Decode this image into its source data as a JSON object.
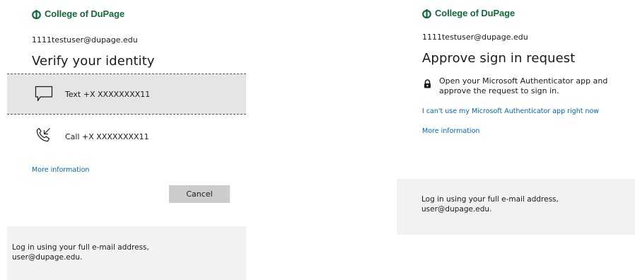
{
  "left": {
    "brand": "College of DuPage",
    "email": "1111testuser@dupage.edu",
    "title": "Verify your identity",
    "options": [
      {
        "label": "Text +X XXXXXXXX11",
        "icon": "message-icon"
      },
      {
        "label": "Call +X XXXXXXXX11",
        "icon": "phone-call-icon"
      }
    ],
    "more_info": "More information",
    "cancel": "Cancel",
    "footer_line1": "Log in using your full e-mail address,",
    "footer_line2": "user@dupage.edu."
  },
  "right": {
    "brand": "College of DuPage",
    "email": "1111testuser@dupage.edu",
    "title": "Approve sign in request",
    "instruction_line1": "Open your Microsoft Authenticator app and",
    "instruction_line2": "approve the request to sign in.",
    "cant_use_link": "I can't use my Microsoft Authenticator app right now",
    "more_info": "More information",
    "footer_line1": "Log in using your full e-mail address,",
    "footer_line2": "user@dupage.edu."
  },
  "colors": {
    "brand_green": "#0f6b3a",
    "link_blue": "#0067b8",
    "selected_bg": "#e5e5e5",
    "footer_bg": "#f2f2f2",
    "button_bg": "#cccccc"
  }
}
